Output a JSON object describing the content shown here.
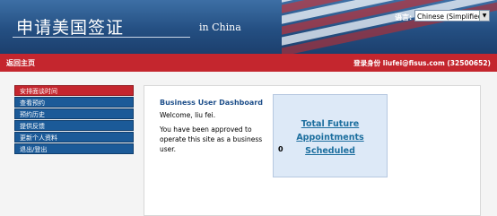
{
  "header": {
    "site_title": "申请美国签证",
    "subtitle": "in China",
    "language_label": "语言:",
    "language_value": "Chinese (Simplified)"
  },
  "topbar": {
    "home_link": "返回主页",
    "login_info": "登录身份 liufei@fisus.com (32500652)"
  },
  "sidebar": {
    "items": [
      {
        "label": "安排面谈时间"
      },
      {
        "label": "查看预约"
      },
      {
        "label": "预约历史"
      },
      {
        "label": "提供反馈"
      },
      {
        "label": "更新个人资料"
      },
      {
        "label": "退出/登出"
      }
    ]
  },
  "main": {
    "dashboard_title": "Business User Dashboard",
    "welcome": "Welcome, liu fei.",
    "approved_text": "You have been approved to operate this site as a business user."
  },
  "appointments": {
    "link_text": "Total Future Appointments Scheduled",
    "count": "0"
  },
  "colors": {
    "header_blue": "#244f82",
    "bar_red": "#c4262e",
    "nav_blue": "#1b5a98",
    "link_blue": "#1c6e9e",
    "appt_box": "#dde9f7"
  }
}
